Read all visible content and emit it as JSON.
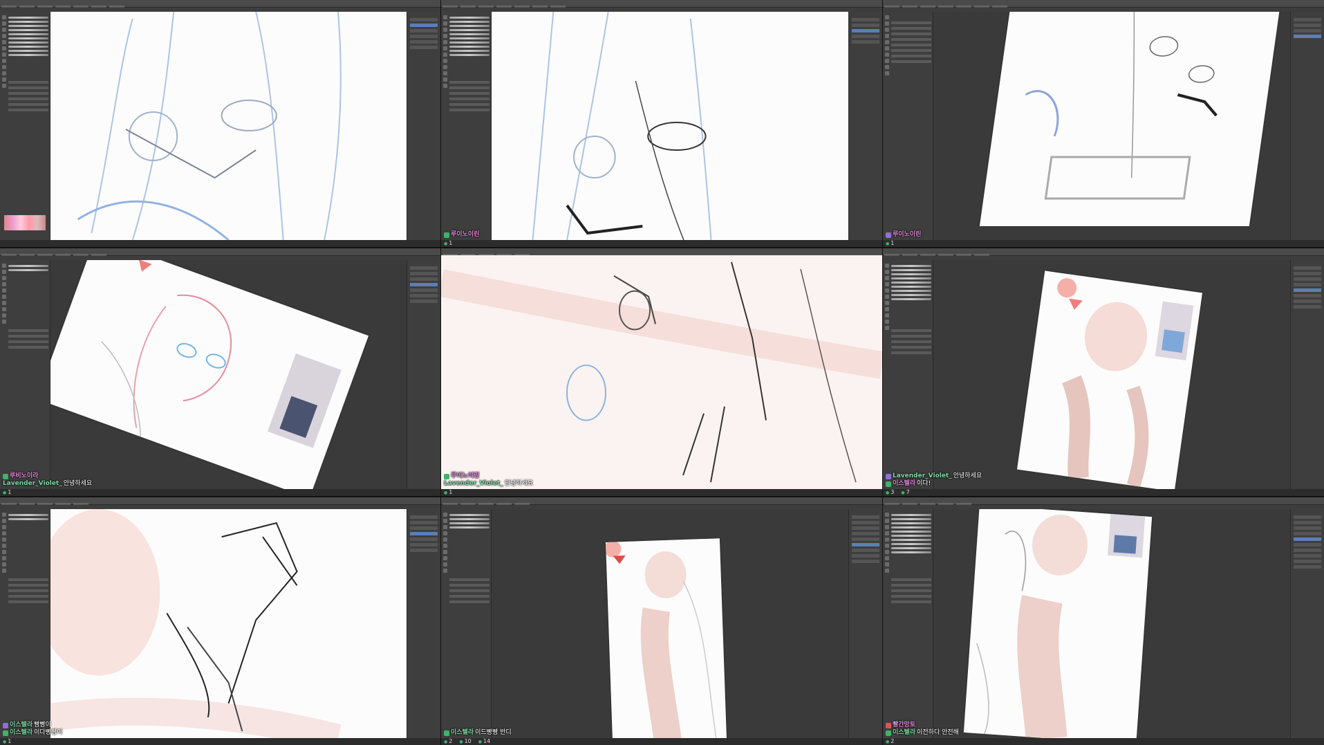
{
  "panels": [
    {
      "id": "p1",
      "tone": "blue",
      "chat": [],
      "viewers": []
    },
    {
      "id": "p2",
      "tone": "blue",
      "chat": [
        {
          "nick": "루이노이린",
          "text": ""
        }
      ],
      "viewers": [
        "1"
      ]
    },
    {
      "id": "p3",
      "tone": "blue",
      "chat": [
        {
          "nick": "루이노이린",
          "text": ""
        }
      ],
      "viewers": [
        "1"
      ]
    },
    {
      "id": "p4",
      "tone": "pink",
      "chat": [
        {
          "nick": "루비노이라",
          "text": ""
        },
        {
          "nick": "Lavender_Violet_",
          "text": "안녕하세요"
        }
      ],
      "viewers": [
        "1"
      ]
    },
    {
      "id": "p5",
      "tone": "pink",
      "chat": [
        {
          "nick": "루이노이린",
          "text": ""
        },
        {
          "nick": "Lavender_Violet_",
          "text": "안녕하세요"
        }
      ],
      "viewers": [
        "1"
      ]
    },
    {
      "id": "p6",
      "tone": "pink",
      "chat": [
        {
          "nick": "Lavender_Violet_",
          "text": "안녕하세요"
        },
        {
          "nick": "이스텔라",
          "text": "이다!"
        }
      ],
      "viewers": [
        "3",
        "7"
      ]
    },
    {
      "id": "p7",
      "tone": "pink",
      "chat": [
        {
          "nick": "이스텔라",
          "text": "빵빵이"
        },
        {
          "nick": "이스텔라",
          "text": "이다빵빵이"
        }
      ],
      "viewers": [
        "1"
      ]
    },
    {
      "id": "p8",
      "tone": "pink",
      "chat": [
        {
          "nick": "이스텔라",
          "text": "이드빵빵 반디"
        }
      ],
      "viewers": [
        "2",
        "10",
        "14"
      ]
    },
    {
      "id": "p9",
      "tone": "pink",
      "chat": [
        {
          "nick": "빨간망토",
          "text": ""
        },
        {
          "nick": "이스텔라",
          "text": "이전하다 안전해"
        }
      ],
      "viewers": [
        "2"
      ]
    }
  ]
}
